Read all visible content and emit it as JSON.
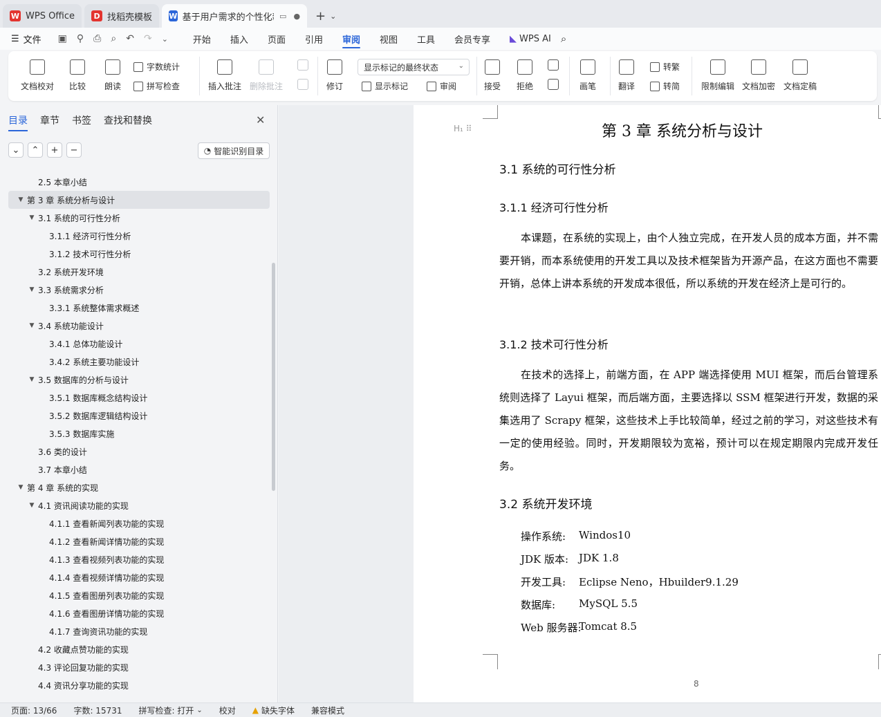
{
  "tabs": [
    {
      "label": "WPS Office",
      "color": "#e3342f",
      "glyph": "W",
      "active": false
    },
    {
      "label": "找稻壳模板",
      "color": "#e3342f",
      "glyph": "D",
      "active": false
    },
    {
      "label": "基于用户需求的个性化新闻推",
      "color": "#2b66d9",
      "glyph": "W",
      "active": true
    }
  ],
  "menubar": {
    "file": "文件",
    "items": [
      "开始",
      "插入",
      "页面",
      "引用",
      "审阅",
      "视图",
      "工具",
      "会员专享"
    ],
    "active": "审阅",
    "ai": "WPS AI"
  },
  "ribbon": {
    "doc_check": "文档校对",
    "compare": "比较",
    "read_aloud": "朗读",
    "word_count": "字数统计",
    "spell_check": "拼写检查",
    "insert_comment": "插入批注",
    "delete_comment": "删除批注",
    "revise": "修订",
    "display_dropdown": "显示标记的最终状态",
    "show_markup": "显示标记",
    "review": "审阅",
    "accept": "接受",
    "reject": "拒绝",
    "draw": "画笔",
    "translate": "翻译",
    "to_traditional": "转繁",
    "to_simplified": "转简",
    "restrict_edit": "限制编辑",
    "doc_encrypt": "文档加密",
    "doc_finalize": "文档定稿"
  },
  "sidebar": {
    "tabs": [
      "目录",
      "章节",
      "书签",
      "查找和替换"
    ],
    "active_tab": "目录",
    "smart_button": "智能识别目录",
    "toc": [
      {
        "text": "2.5  本章小结",
        "level": 2,
        "arrow": ""
      },
      {
        "text": "第 3 章  系统分析与设计",
        "level": 1,
        "arrow": "▼",
        "selected": true
      },
      {
        "text": "3.1  系统的可行性分析",
        "level": 2,
        "arrow": "▼"
      },
      {
        "text": "3.1.1  经济可行性分析",
        "level": 3,
        "arrow": ""
      },
      {
        "text": "3.1.2  技术可行性分析",
        "level": 3,
        "arrow": ""
      },
      {
        "text": "3.2  系统开发环境",
        "level": 2,
        "arrow": ""
      },
      {
        "text": "3.3  系统需求分析",
        "level": 2,
        "arrow": "▼"
      },
      {
        "text": "3.3.1 系统整体需求概述",
        "level": 3,
        "arrow": ""
      },
      {
        "text": "3.4  系统功能设计",
        "level": 2,
        "arrow": "▼"
      },
      {
        "text": "3.4.1  总体功能设计",
        "level": 3,
        "arrow": ""
      },
      {
        "text": "3.4.2  系统主要功能设计",
        "level": 3,
        "arrow": ""
      },
      {
        "text": "3.5  数据库的分析与设计",
        "level": 2,
        "arrow": "▼"
      },
      {
        "text": "3.5.1  数据库概念结构设计",
        "level": 3,
        "arrow": ""
      },
      {
        "text": "3.5.2  数据库逻辑结构设计",
        "level": 3,
        "arrow": ""
      },
      {
        "text": "3.5.3  数据库实施",
        "level": 3,
        "arrow": ""
      },
      {
        "text": "3.6  类的设计",
        "level": 2,
        "arrow": ""
      },
      {
        "text": "3.7  本章小结",
        "level": 2,
        "arrow": ""
      },
      {
        "text": "第 4 章  系统的实现",
        "level": 1,
        "arrow": "▼"
      },
      {
        "text": "4.1 资讯阅读功能的实现",
        "level": 2,
        "arrow": "▼"
      },
      {
        "text": "4.1.1 查看新闻列表功能的实现",
        "level": 3,
        "arrow": ""
      },
      {
        "text": "4.1.2 查看新闻详情功能的实现",
        "level": 3,
        "arrow": ""
      },
      {
        "text": "4.1.3 查看视频列表功能的实现",
        "level": 3,
        "arrow": ""
      },
      {
        "text": "4.1.4 查看视频详情功能的实现",
        "level": 3,
        "arrow": ""
      },
      {
        "text": "4.1.5 查看图册列表功能的实现",
        "level": 3,
        "arrow": ""
      },
      {
        "text": "4.1.6 查看图册详情功能的实现",
        "level": 3,
        "arrow": ""
      },
      {
        "text": "4.1.7 查询资讯功能的实现",
        "level": 3,
        "arrow": ""
      },
      {
        "text": "4.2 收藏点赞功能的实现",
        "level": 2,
        "arrow": ""
      },
      {
        "text": "4.3 评论回复功能的实现",
        "level": 2,
        "arrow": ""
      },
      {
        "text": "4.4 资讯分享功能的实现",
        "level": 2,
        "arrow": ""
      }
    ]
  },
  "document": {
    "chapter_title": "第 3 章  系统分析与设计",
    "s31": "3.1  系统的可行性分析",
    "s311": "3.1.1  经济可行性分析",
    "p311": "本课题，在系统的实现上，由个人独立完成，在开发人员的成本方面，并不需要开销，而本系统使用的开发工具以及技术框架皆为开源产品，在这方面也不需要开销，总体上讲本系统的开发成本很低，所以系统的开发在经济上是可行的。",
    "s312": "3.1.2  技术可行性分析",
    "p312": "在技术的选择上，前端方面，在 APP 端选择使用 MUI 框架，而后台管理系统则选择了 Layui 框架，而后端方面，主要选择以 SSM 框架进行开发，数据的采集选用了 Scrapy 框架，这些技术上手比较简单，经过之前的学习，对这些技术有一定的使用经验。同时，开发期限较为宽裕，预计可以在规定期限内完成开发任务。",
    "s32": "3.2  系统开发环境",
    "env": [
      {
        "k": "操作系统:",
        "v": "Windos10"
      },
      {
        "k": "JDK 版本:",
        "v": "JDK 1.8"
      },
      {
        "k": "开发工具:",
        "v": "Eclipse Neno，Hbuilder9.1.29"
      },
      {
        "k": "数据库:",
        "v": "MySQL 5.5"
      },
      {
        "k": "Web 服务器:",
        "v": "Tomcat 8.5"
      }
    ],
    "page_number": "8"
  },
  "statusbar": {
    "page": "页面: 13/66",
    "words": "字数: 15731",
    "spell": "拼写检查: 打开",
    "proofread": "校对",
    "missing_font": "缺失字体",
    "compat": "兼容模式"
  }
}
